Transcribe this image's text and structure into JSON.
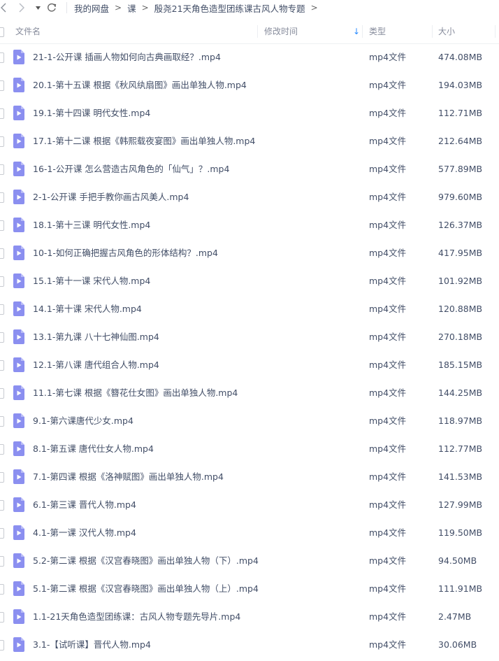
{
  "toolbar": {
    "icons": [
      "chevron-left-icon",
      "chevron-right-icon",
      "dropdown-caret-icon",
      "refresh-icon"
    ]
  },
  "breadcrumb": {
    "items": [
      "我的网盘",
      "课",
      "殷尧21天角色造型团练课古风人物专题"
    ],
    "separator": ">"
  },
  "header": {
    "name": "文件名",
    "modified": "修改时间",
    "type": "类型",
    "size": "大小",
    "sort_indicator": "↓"
  },
  "colors": {
    "file_icon": "#8b8ff0",
    "sort_accent": "#2a8cff",
    "text": "#424e67"
  },
  "files": [
    {
      "name": "21-1-公开课 插画人物如何向古典画取经？.mp4",
      "type": "mp4文件",
      "size": "474.08MB"
    },
    {
      "name": "20.1-第十五课 根据《秋风纨扇图》画出单独人物.mp4",
      "type": "mp4文件",
      "size": "194.03MB"
    },
    {
      "name": "19.1-第十四课 明代女性.mp4",
      "type": "mp4文件",
      "size": "112.71MB"
    },
    {
      "name": "17.1-第十二课 根据《韩熙载夜宴图》画出单独人物.mp4",
      "type": "mp4文件",
      "size": "212.64MB"
    },
    {
      "name": "16-1-公开课 怎么营造古风角色的「仙气」？.mp4",
      "type": "mp4文件",
      "size": "577.89MB"
    },
    {
      "name": "2-1-公开课 手把手教你画古风美人.mp4",
      "type": "mp4文件",
      "size": "979.60MB"
    },
    {
      "name": "18.1-第十三课 明代女性.mp4",
      "type": "mp4文件",
      "size": "126.37MB"
    },
    {
      "name": "10-1-如何正确把握古风角色的形体结构？.mp4",
      "type": "mp4文件",
      "size": "417.95MB"
    },
    {
      "name": "15.1-第十一课 宋代人物.mp4",
      "type": "mp4文件",
      "size": "101.92MB"
    },
    {
      "name": "14.1-第十课 宋代人物.mp4",
      "type": "mp4文件",
      "size": "120.88MB"
    },
    {
      "name": "13.1-第九课 八十七神仙图.mp4",
      "type": "mp4文件",
      "size": "270.18MB"
    },
    {
      "name": "12.1-第八课 唐代组合人物.mp4",
      "type": "mp4文件",
      "size": "185.15MB"
    },
    {
      "name": "11.1-第七课 根据《簪花仕女图》画出单独人物.mp4",
      "type": "mp4文件",
      "size": "144.25MB"
    },
    {
      "name": "9.1-第六课唐代少女.mp4",
      "type": "mp4文件",
      "size": "118.97MB"
    },
    {
      "name": "8.1-第五课 唐代仕女人物.mp4",
      "type": "mp4文件",
      "size": "112.77MB"
    },
    {
      "name": "7.1-第四课 根据《洛神赋图》画出单独人物.mp4",
      "type": "mp4文件",
      "size": "141.53MB"
    },
    {
      "name": "6.1-第三课 晋代人物.mp4",
      "type": "mp4文件",
      "size": "127.99MB"
    },
    {
      "name": "4.1-第一课 汉代人物.mp4",
      "type": "mp4文件",
      "size": "119.50MB"
    },
    {
      "name": "5.2-第二课 根据《汉宫春晓图》画出单独人物（下）.mp4",
      "type": "mp4文件",
      "size": "94.50MB"
    },
    {
      "name": "5.1-第二课 根据《汉宫春晓图》画出单独人物（上）.mp4",
      "type": "mp4文件",
      "size": "111.91MB"
    },
    {
      "name": "1.1-21天角色造型团练课：古风人物专题先导片.mp4",
      "type": "mp4文件",
      "size": "2.47MB"
    },
    {
      "name": "3.1-【试听课】晋代人物.mp4",
      "type": "mp4文件",
      "size": "30.06MB"
    }
  ]
}
